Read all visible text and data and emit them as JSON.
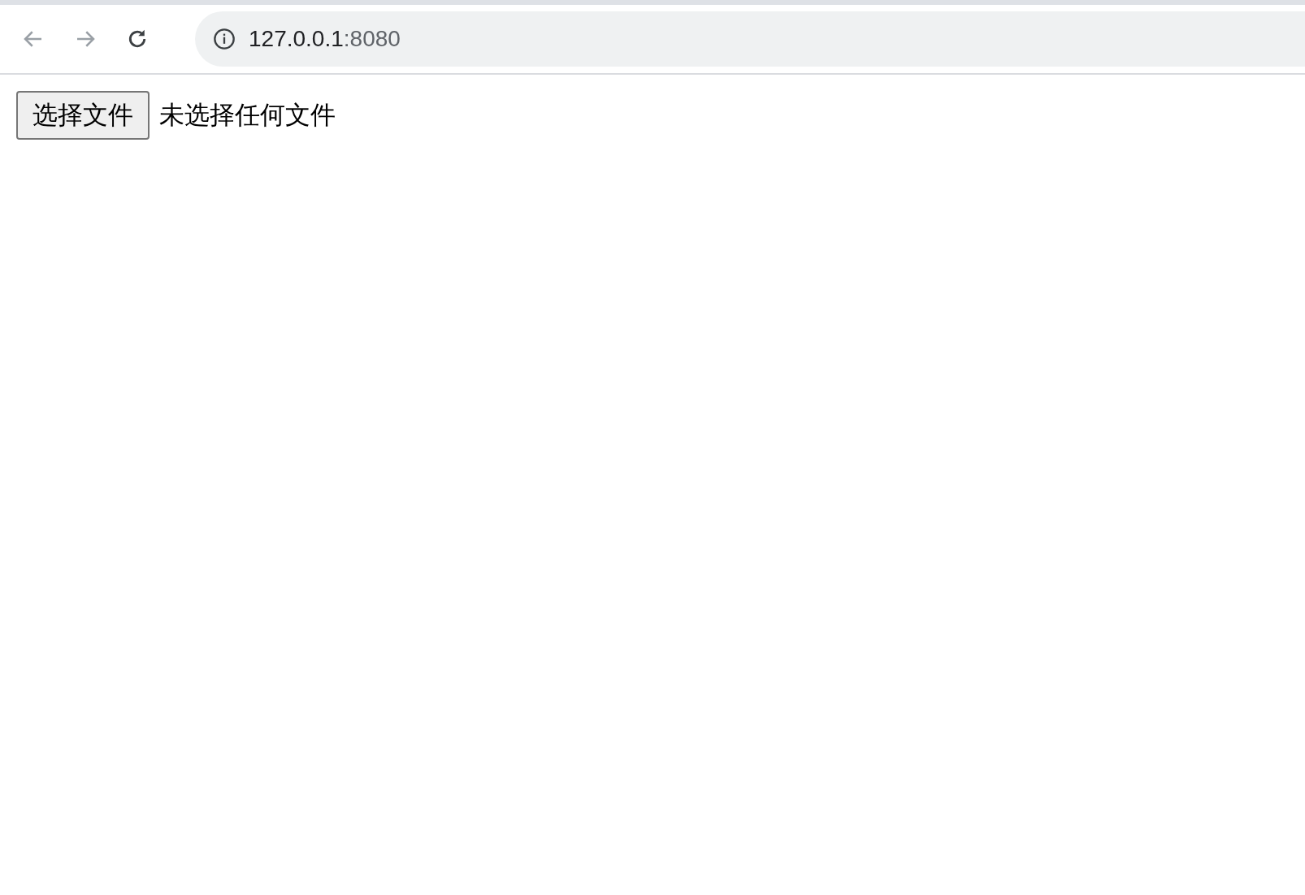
{
  "toolbar": {
    "url_host": "127.0.0.1",
    "url_rest": ":8080"
  },
  "file_input": {
    "button": "选择文件",
    "status": "未选择任何文件"
  }
}
